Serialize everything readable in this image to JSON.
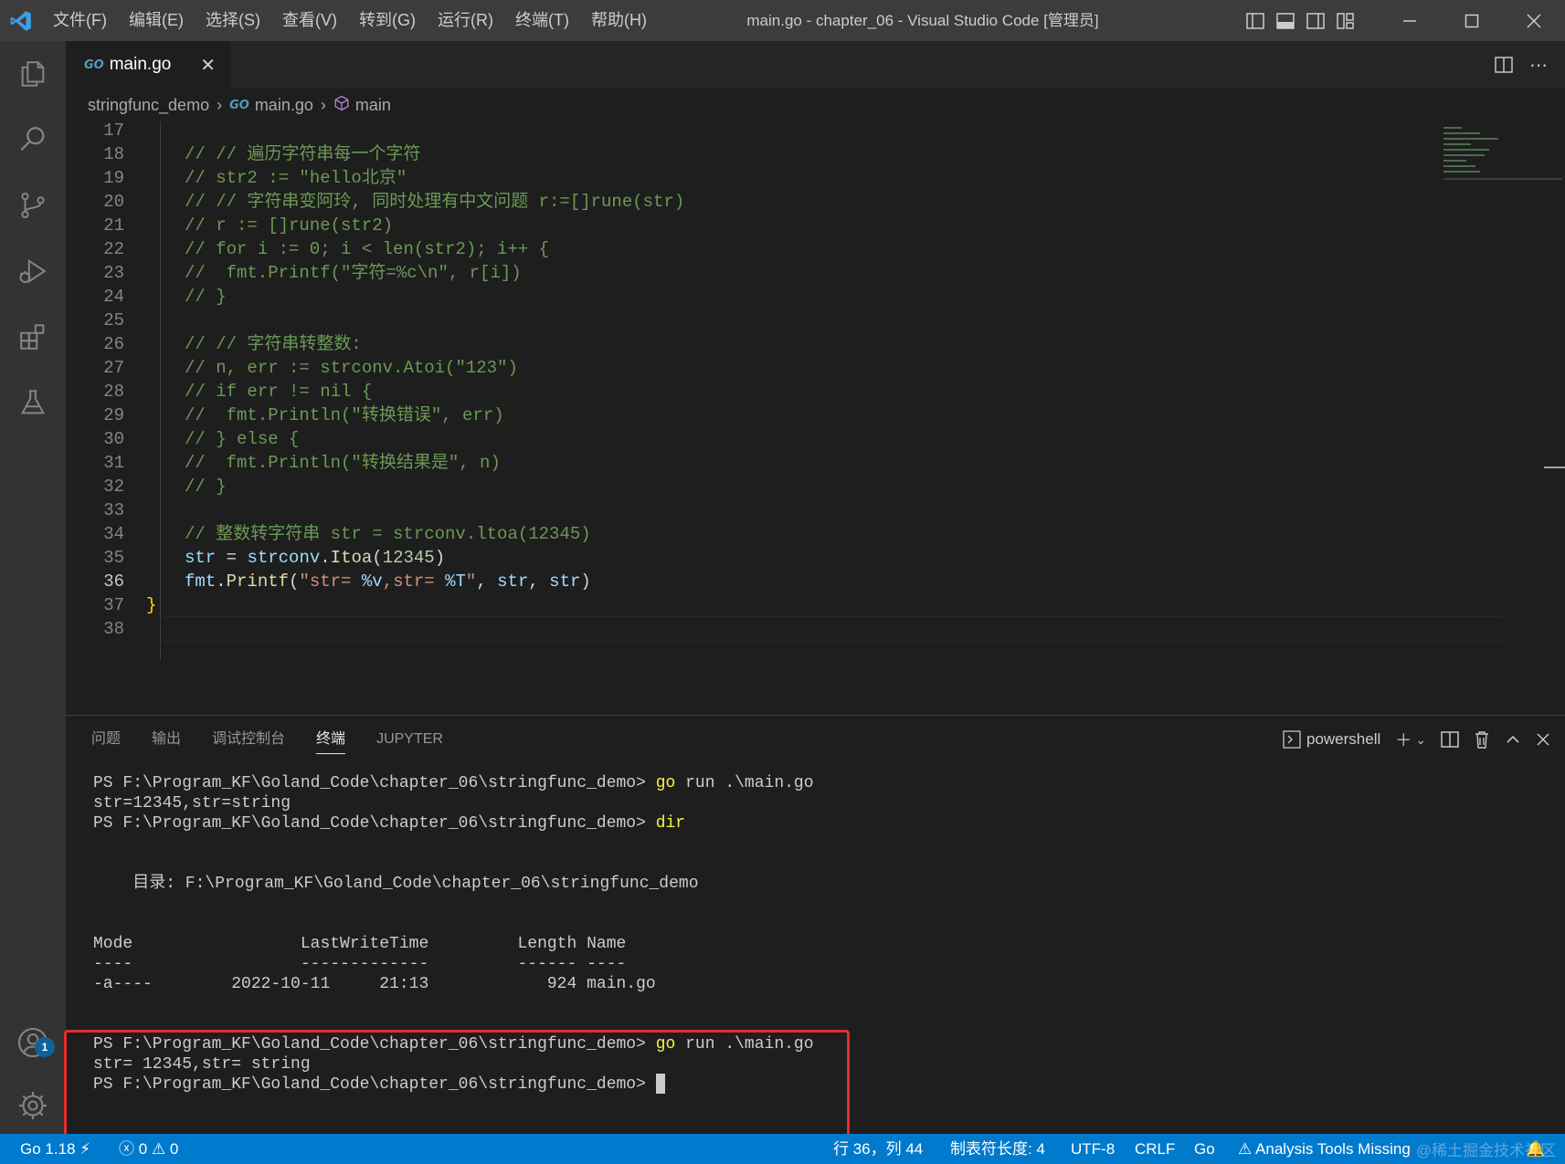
{
  "titlebar": {
    "menu": [
      "文件(F)",
      "编辑(E)",
      "选择(S)",
      "查看(V)",
      "转到(G)",
      "运行(R)",
      "终端(T)",
      "帮助(H)"
    ],
    "window_title": "main.go - chapter_06 - Visual Studio Code [管理员]"
  },
  "tabs": [
    {
      "icon": "GO",
      "label": "main.go"
    }
  ],
  "breadcrumb": {
    "folder": "stringfunc_demo",
    "file": "main.go",
    "symbol": "main"
  },
  "editor": {
    "active_line": 36,
    "lines": [
      {
        "n": "17",
        "code": ""
      },
      {
        "n": "18",
        "code": "// // 遍历字符串每一个字符"
      },
      {
        "n": "19",
        "code": "// str2 := \"hello北京\""
      },
      {
        "n": "20",
        "code": "// // 字符串变阿玲, 同时处理有中文问题 r:=[]rune(str)"
      },
      {
        "n": "21",
        "code": "// r := []rune(str2)"
      },
      {
        "n": "22",
        "code": "// for i := 0; i < len(str2); i++ {"
      },
      {
        "n": "23",
        "code": "//  fmt.Printf(\"字符=%c\\n\", r[i])"
      },
      {
        "n": "24",
        "code": "// }"
      },
      {
        "n": "25",
        "code": ""
      },
      {
        "n": "26",
        "code": "// // 字符串转整数:"
      },
      {
        "n": "27",
        "code": "// n, err := strconv.Atoi(\"123\")"
      },
      {
        "n": "28",
        "code": "// if err != nil {"
      },
      {
        "n": "29",
        "code": "//  fmt.Println(\"转换错误\", err)"
      },
      {
        "n": "30",
        "code": "// } else {"
      },
      {
        "n": "31",
        "code": "//  fmt.Println(\"转换结果是\", n)"
      },
      {
        "n": "32",
        "code": "// }"
      },
      {
        "n": "33",
        "code": ""
      },
      {
        "n": "34",
        "code": "// 整数转字符串 str = strconv.ltoa(12345)"
      },
      {
        "n": "35",
        "code": "str = strconv.Itoa(12345)"
      },
      {
        "n": "36",
        "code": "fmt.Printf(\"str= %v,str= %T\", str, str)"
      },
      {
        "n": "37",
        "code": "}"
      },
      {
        "n": "38",
        "code": ""
      }
    ]
  },
  "panel": {
    "tabs": [
      "问题",
      "输出",
      "调试控制台",
      "终端",
      "JUPYTER"
    ],
    "active_tab": "终端",
    "shell": "powershell",
    "terminal": [
      {
        "prompt": "PS F:\\Program_KF\\Goland_Code\\chapter_06\\stringfunc_demo> ",
        "cmd": "go",
        "rest": " run .\\main.go"
      },
      {
        "text": "str=12345,str=string"
      },
      {
        "prompt": "PS F:\\Program_KF\\Goland_Code\\chapter_06\\stringfunc_demo> ",
        "cmd": "dir",
        "rest": ""
      },
      {
        "text": "    目录: F:\\Program_KF\\Goland_Code\\chapter_06\\stringfunc_demo"
      },
      {
        "text": "Mode                 LastWriteTime         Length Name"
      },
      {
        "text": "----                 -------------         ------ ----"
      },
      {
        "text": "-a----        2022-10-11     21:13            924 main.go"
      },
      {
        "prompt": "PS F:\\Program_KF\\Goland_Code\\chapter_06\\stringfunc_demo> ",
        "cmd": "go",
        "rest": " run .\\main.go"
      },
      {
        "text": "str= 12345,str= string"
      },
      {
        "prompt": "PS F:\\Program_KF\\Goland_Code\\chapter_06\\stringfunc_demo> ",
        "cmd": "",
        "rest": ""
      }
    ]
  },
  "activity": {
    "accounts_badge": "1"
  },
  "statusbar": {
    "go_version": "Go 1.18",
    "errors": "0",
    "warnings": "0",
    "position": "行 36，列 44",
    "tab_size": "制表符长度: 4",
    "encoding": "UTF-8",
    "eol": "CRLF",
    "language": "Go",
    "analysis": "Analysis Tools Missing"
  },
  "watermark": "@稀土掘金技术社区",
  "colors": {
    "accent": "#007acc",
    "highlight_box": "#e52d2d"
  }
}
